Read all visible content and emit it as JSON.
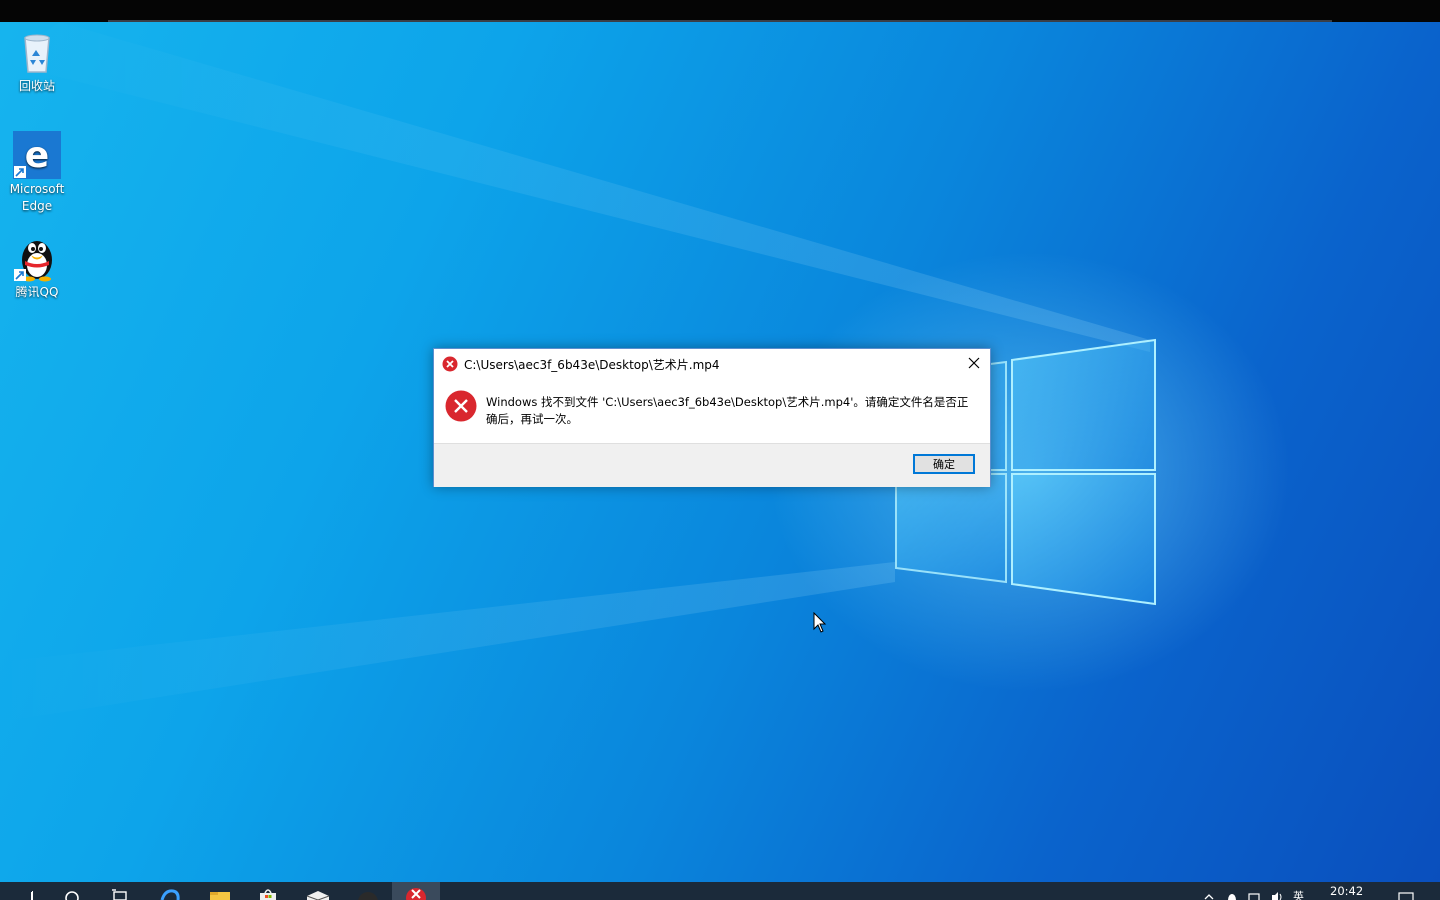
{
  "desktop": {
    "icons": [
      {
        "label": "回收站"
      },
      {
        "label": "Microsoft Edge"
      },
      {
        "label": "腾讯QQ"
      }
    ]
  },
  "dialog": {
    "title": "C:\\Users\\aec3f_6b43e\\Desktop\\艺术片.mp4",
    "message": "Windows 找不到文件 'C:\\Users\\aec3f_6b43e\\Desktop\\艺术片.mp4'。请确定文件名是否正确后，再试一次。",
    "ok_label": "确定",
    "error_color": "#e81123"
  },
  "taskbar": {
    "items": [
      "start-icon",
      "search-icon",
      "task-view-icon",
      "edge-icon",
      "file-explorer-icon",
      "store-icon",
      "mail-icon",
      "media-app-icon",
      "error-dialog-icon"
    ],
    "language": "英",
    "clock": "20:42"
  }
}
